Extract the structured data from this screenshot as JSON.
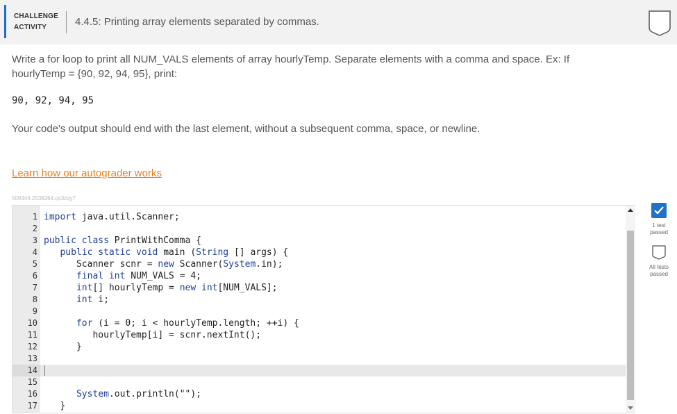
{
  "header": {
    "badge_line1": "CHALLENGE",
    "badge_line2": "ACTIVITY",
    "title": "4.4.5: Printing array elements separated by commas."
  },
  "description": {
    "paragraph1": "Write a for loop to print all NUM_VALS elements of array hourlyTemp. Separate elements with a comma and space. Ex: If hourlyTemp = {90, 92, 94, 95}, print:",
    "example_output": "90, 92, 94, 95",
    "paragraph2": "Your code's output should end with the last element, without a subsequent comma, space, or newline."
  },
  "learn_link": "Learn how our autograder works",
  "identifier": "509344.2538264.qx3zqy7",
  "editor": {
    "lines": [
      {
        "n": "1",
        "segs": [
          [
            "kw",
            "import"
          ],
          [
            "tx",
            " java.util.Scanner;"
          ]
        ]
      },
      {
        "n": "2",
        "segs": []
      },
      {
        "n": "3",
        "segs": [
          [
            "kw",
            "public class"
          ],
          [
            "tx",
            " PrintWithComma {"
          ]
        ]
      },
      {
        "n": "4",
        "segs": [
          [
            "tx",
            "   "
          ],
          [
            "kw",
            "public static void"
          ],
          [
            "tx",
            " main ("
          ],
          [
            "kw",
            "String"
          ],
          [
            "tx",
            " [] args) {"
          ]
        ]
      },
      {
        "n": "5",
        "segs": [
          [
            "tx",
            "      Scanner scnr = "
          ],
          [
            "kw",
            "new"
          ],
          [
            "tx",
            " Scanner("
          ],
          [
            "kw",
            "System"
          ],
          [
            "tx",
            ".in);"
          ]
        ]
      },
      {
        "n": "6",
        "segs": [
          [
            "tx",
            "      "
          ],
          [
            "kw",
            "final int"
          ],
          [
            "tx",
            " NUM_VALS = 4;"
          ]
        ]
      },
      {
        "n": "7",
        "segs": [
          [
            "tx",
            "      "
          ],
          [
            "kw",
            "int"
          ],
          [
            "tx",
            "[] hourlyTemp = "
          ],
          [
            "kw",
            "new int"
          ],
          [
            "tx",
            "[NUM_VALS];"
          ]
        ]
      },
      {
        "n": "8",
        "segs": [
          [
            "tx",
            "      "
          ],
          [
            "kw",
            "int"
          ],
          [
            "tx",
            " i;"
          ]
        ]
      },
      {
        "n": "9",
        "segs": []
      },
      {
        "n": "10",
        "segs": [
          [
            "tx",
            "      "
          ],
          [
            "kw",
            "for"
          ],
          [
            "tx",
            " (i = 0; i < hourlyTemp.length; ++i) {"
          ]
        ]
      },
      {
        "n": "11",
        "segs": [
          [
            "tx",
            "         hourlyTemp[i] = scnr.nextInt();"
          ]
        ]
      },
      {
        "n": "12",
        "segs": [
          [
            "tx",
            "      }"
          ]
        ]
      },
      {
        "n": "13",
        "segs": []
      },
      {
        "n": "14",
        "segs": []
      },
      {
        "n": "15",
        "segs": []
      },
      {
        "n": "16",
        "segs": [
          [
            "tx",
            "      "
          ],
          [
            "kw",
            "System"
          ],
          [
            "tx",
            ".out.println("
          ],
          [
            "tx",
            "\"\""
          ],
          [
            "tx",
            ");"
          ]
        ]
      },
      {
        "n": "17",
        "segs": [
          [
            "tx",
            "   }"
          ]
        ]
      }
    ]
  },
  "tests": {
    "test1_line1": "1 test",
    "test1_line2": "passed",
    "test2_line1": "All tests",
    "test2_line2": "passed"
  },
  "colors": {
    "accent": "#1e6fc0",
    "link": "#e8821e",
    "keyword": "#1f3f99",
    "check_pass": "#1e73c8"
  }
}
